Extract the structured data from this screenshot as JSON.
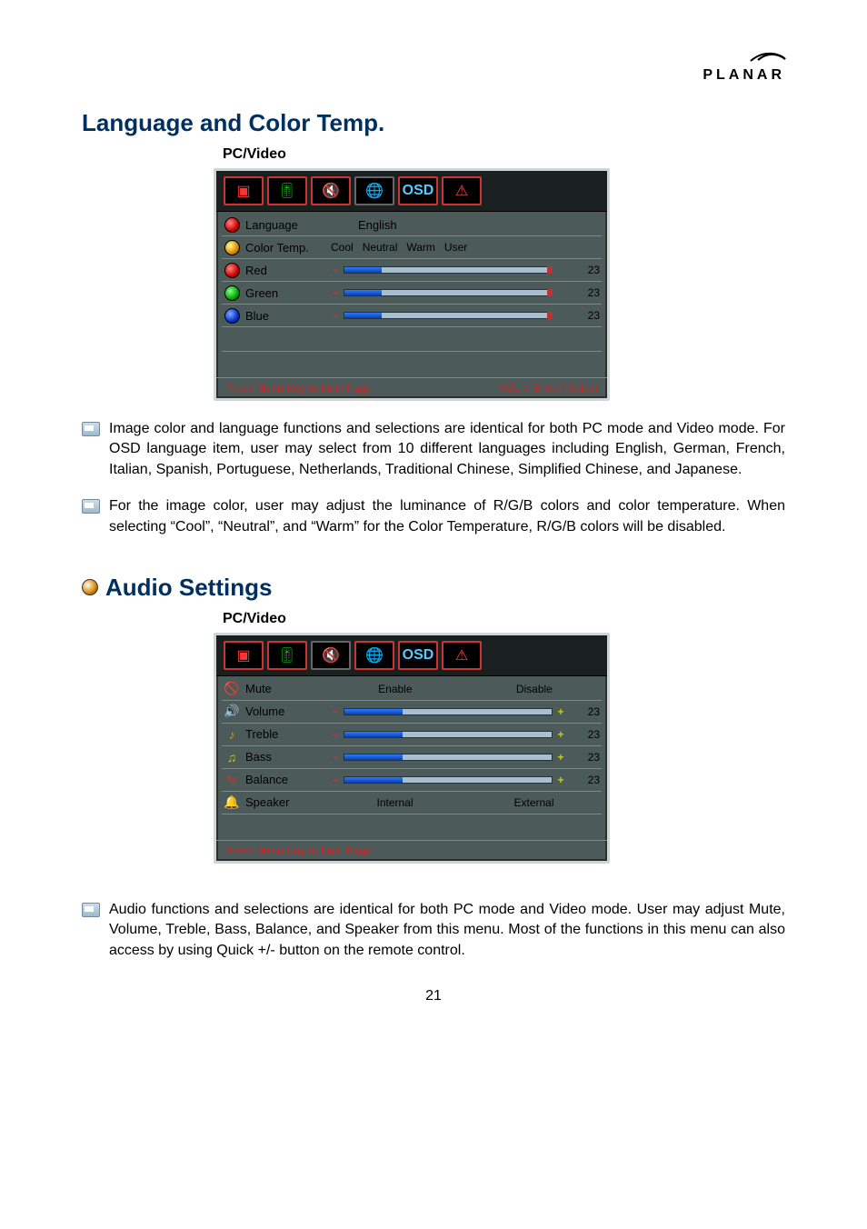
{
  "brand": "PLANAR",
  "section1_title": "Language and Color Temp.",
  "section2_title": "Audio Settings",
  "subhead": "PC/Video",
  "osd1": {
    "rows": {
      "language": {
        "label": "Language",
        "value": "English"
      },
      "colortemp": {
        "label": "Color Temp.",
        "options": [
          "Cool",
          "Neutral",
          "Warm",
          "User"
        ]
      },
      "red": {
        "label": "Red",
        "value": 23
      },
      "green": {
        "label": "Green",
        "value": 23
      },
      "blue": {
        "label": "Blue",
        "value": 23
      }
    },
    "footer_left": "Press Menu Key to Next Page",
    "footer_right": "VOL > Enter / Select"
  },
  "osd2": {
    "rows": {
      "mute": {
        "label": "Mute",
        "options": [
          "Enable",
          "Disable"
        ]
      },
      "volume": {
        "label": "Volume",
        "value": 23
      },
      "treble": {
        "label": "Treble",
        "value": 23
      },
      "bass": {
        "label": "Bass",
        "value": 23
      },
      "balance": {
        "label": "Balance",
        "value": 23
      },
      "speaker": {
        "label": "Speaker",
        "options": [
          "Internal",
          "External"
        ]
      }
    },
    "footer_left": "Press Menu Key to Next Page"
  },
  "para1": "Image color and language functions and selections are identical for both PC mode and Video mode. For OSD language item, user may select from 10 different languages including English, German, French, Italian, Spanish, Portuguese, Netherlands, Traditional Chinese, Simplified Chinese, and Japanese.",
  "para2": "For the image color, user may adjust the luminance of R/G/B colors and color temperature. When selecting “Cool”, “Neutral”, and “Warm” for the Color Temperature, R/G/B colors will be disabled.",
  "para3": "Audio functions and selections are identical for both PC mode and Video mode. User may adjust Mute, Volume, Treble, Bass, Balance, and Speaker from this menu. Most of the functions in this menu can also access by using Quick +/- button on the remote control.",
  "page_number": "21"
}
